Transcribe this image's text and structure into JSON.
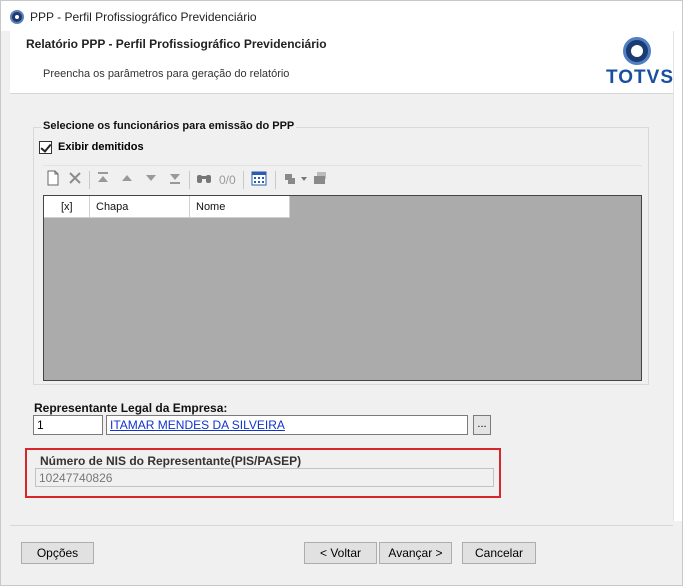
{
  "window": {
    "title": "PPP - Perfil Profissiográfico Previdenciário"
  },
  "header": {
    "title": "Relatório PPP - Perfil Profissiográfico Previdenciário",
    "subtitle": "Preencha os parâmetros para geração do relatório",
    "logo_text": "TOTVS"
  },
  "employees": {
    "group_title": "Selecione os funcionários para emissão do PPP",
    "show_dismissed_label": "Exibir demitidos",
    "show_dismissed_checked": true,
    "toolbar": {
      "icons": [
        "new-icon",
        "delete-icon",
        "first-icon",
        "previous-icon",
        "next-icon",
        "last-icon",
        "find-icon",
        "calendar-grid-icon",
        "process-icon",
        "dropdown-arrow-icon",
        "print-icon"
      ],
      "counter": "0/0"
    },
    "grid": {
      "columns": [
        "[x]",
        "Chapa",
        "Nome"
      ],
      "rows": []
    }
  },
  "representative": {
    "label": "Representante Legal da Empresa:",
    "code": "1",
    "name": "ITAMAR MENDES DA SILVEIRA",
    "lookup_label": "..."
  },
  "nis": {
    "label": "Número de NIS do Representante(PIS/PASEP)",
    "value": "10247740826"
  },
  "buttons": {
    "options": "Opções",
    "back": "< Voltar",
    "next": "Avançar >",
    "cancel": "Cancelar"
  },
  "colors": {
    "highlight_border": "#d8262d",
    "link": "#1033cc",
    "brand": "#1a4fa0"
  }
}
